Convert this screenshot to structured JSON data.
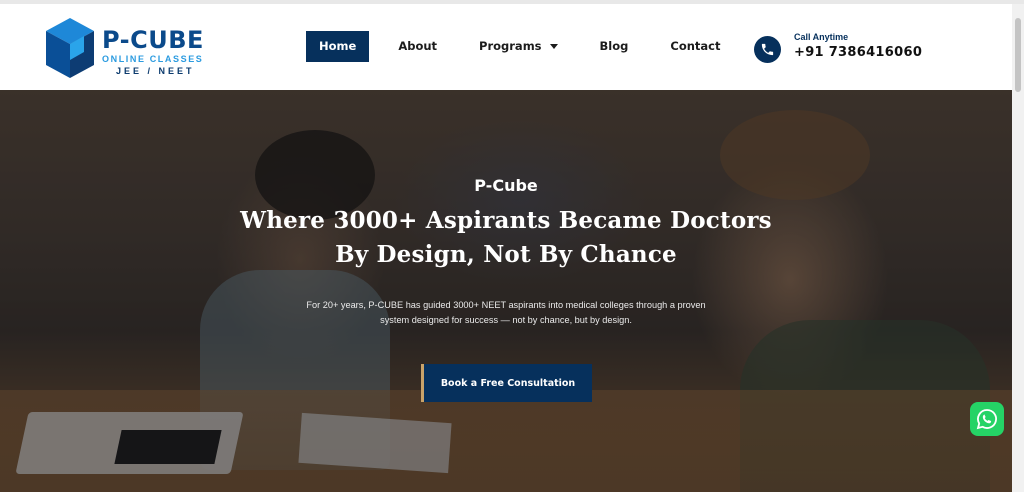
{
  "brand": {
    "name": "P-CUBE",
    "tagline": "ONLINE CLASSES",
    "subtag": "JEE / NEET",
    "colors": {
      "primary": "#06305c",
      "accent": "#2b9be0",
      "cta_border": "#c9a36a"
    }
  },
  "nav": {
    "items": [
      {
        "label": "Home",
        "active": true
      },
      {
        "label": "About",
        "active": false
      },
      {
        "label": "Programs",
        "active": false,
        "has_dropdown": true
      },
      {
        "label": "Blog",
        "active": false
      },
      {
        "label": "Contact",
        "active": false
      }
    ]
  },
  "call": {
    "icon": "phone-icon",
    "label": "Call Anytime",
    "number": "+91 7386416060"
  },
  "hero": {
    "eyebrow": "P-Cube",
    "headline_line1": "Where 3000+ Aspirants Became Doctors",
    "headline_line2": "By Design, Not By Chance",
    "description": "For 20+ years, P-CUBE has guided 3000+ NEET aspirants into medical colleges through a proven system designed for success — not by chance, but by design.",
    "cta_label": "Book a Free Consultation"
  },
  "floating": {
    "whatsapp_icon": "whatsapp-icon"
  }
}
